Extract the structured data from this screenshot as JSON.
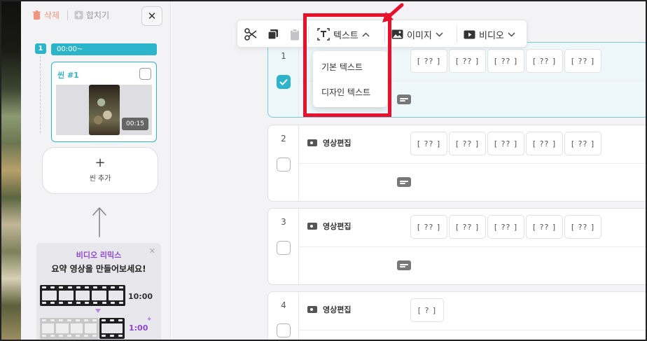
{
  "sidebar": {
    "delete_label": "삭제",
    "merge_label": "합치기",
    "close_glyph": "✕",
    "scene_number": "1",
    "scene_time": "00:00~",
    "scene_title": "씬 #1",
    "scene_duration": "00:15",
    "add_scene_plus": "+",
    "add_scene_label": "씬 추가",
    "remix": {
      "title": "비디오 리믹스",
      "close_glyph": "✕",
      "headline": "요약 영상을 만들어보세요!",
      "from_time": "10:00",
      "to_time": "1:00",
      "sparkle": "✦"
    }
  },
  "toolbar": {
    "text_label": "텍스트",
    "text_chevron": "^",
    "image_label": "이미지",
    "image_chevron": "⌄",
    "video_label": "비디오",
    "video_chevron": "⌄"
  },
  "text_menu": {
    "items": [
      "기본 텍스트",
      "디자인 텍스트"
    ]
  },
  "rows": [
    {
      "number": "1",
      "label": "",
      "checked": true,
      "chips": [
        "[ ?? ]",
        "[ ?? ]",
        "[ ?? ]",
        "[ ?? ]",
        "[ ?? ]"
      ]
    },
    {
      "number": "2",
      "label": "영상편집",
      "checked": false,
      "chips": [
        "[ ?? ]",
        "[ ?? ]",
        "[ ?? ]",
        "[ ?? ]",
        "[ ?? ]"
      ]
    },
    {
      "number": "3",
      "label": "영상편집",
      "checked": false,
      "chips": [
        "[ ?? ]",
        "[ ?? ]",
        "[ ?? ]",
        "[ ?? ]",
        "[ ?? ]"
      ]
    },
    {
      "number": "4",
      "label": "영상편집",
      "checked": false,
      "chips": [
        "[ ? ]"
      ]
    }
  ],
  "colors": {
    "accent": "#2bb4ca",
    "highlight": "#e8102a",
    "remix_purple": "#8e45d4",
    "delete_red": "#f0957f"
  }
}
